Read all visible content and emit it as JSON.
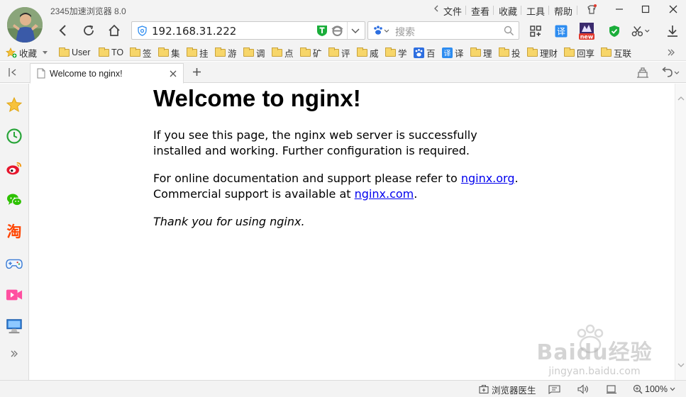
{
  "window": {
    "title": "2345加速浏览器 8.0",
    "menus": [
      "文件",
      "查看",
      "收藏",
      "工具",
      "帮助"
    ]
  },
  "navigation": {
    "address": "192.168.31.222",
    "search_placeholder": "搜索"
  },
  "bookmarks": {
    "favorites_label": "收藏",
    "items": [
      "User",
      "TO",
      "签",
      "集",
      "挂",
      "游",
      "调",
      "点",
      "矿",
      "评",
      "威",
      "学",
      "百",
      "译",
      "理",
      "投",
      "理财",
      "回享",
      "互联"
    ]
  },
  "tabs": [
    {
      "label": "Welcome to nginx!",
      "active": true
    }
  ],
  "page": {
    "title": "Welcome to nginx!",
    "paragraph1": "If you see this page, the nginx web server is successfully installed and working. Further configuration is required.",
    "paragraph2_line1_before": "For online documentation and support please refer to ",
    "paragraph2_link1": "nginx.org",
    "paragraph2_line1_after": ".",
    "paragraph2_line2_before": "Commercial support is available at ",
    "paragraph2_link2": "nginx.com",
    "paragraph2_line2_after": ".",
    "thanks": "Thank you for using nginx."
  },
  "statusbar": {
    "doctor_label": "浏览器医生",
    "zoom": "100%"
  },
  "watermark": {
    "line1": "Baidu经验",
    "line2": "jingyan.baidu.com"
  },
  "colors": {
    "link": "#0000ee",
    "accent_green": "#1aad3a",
    "accent_blue": "#2d8cf0",
    "accent_red": "#e03a2f"
  }
}
